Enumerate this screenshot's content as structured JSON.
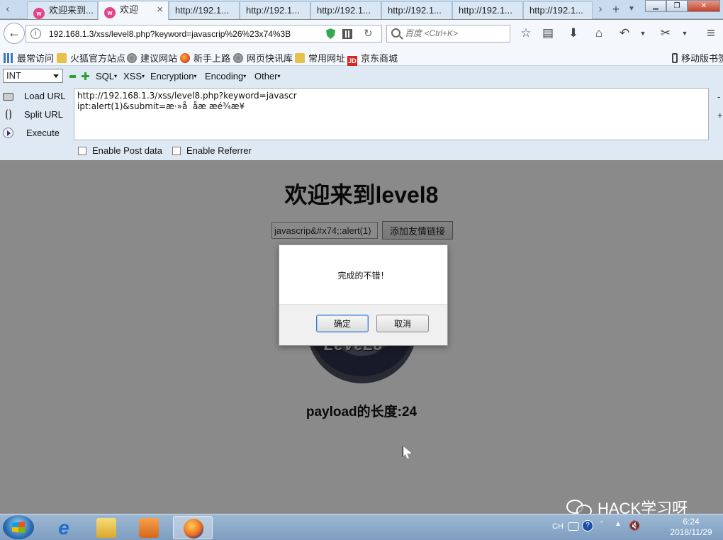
{
  "tabs": [
    {
      "label": "欢迎来到...",
      "active": false
    },
    {
      "label": "欢迎",
      "active": true
    },
    {
      "label": "http://192.1...",
      "active": false
    },
    {
      "label": "http://192.1...",
      "active": false
    },
    {
      "label": "http://192.1...",
      "active": false
    },
    {
      "label": "http://192.1...",
      "active": false
    },
    {
      "label": "http://192.1...",
      "active": false
    },
    {
      "label": "http://192.1...",
      "active": false
    }
  ],
  "nav": {
    "url": "192.168.1.3/xss/level8.php?keyword=javascrip%26%23x74%3B",
    "search_placeholder": "百度 <Ctrl+K>"
  },
  "bookmarks": [
    {
      "label": "最常访问",
      "icon": "grid-icon"
    },
    {
      "label": "火狐官方站点",
      "icon": "folder-icon"
    },
    {
      "label": "建议网站",
      "icon": "globe-icon"
    },
    {
      "label": "新手上路",
      "icon": "firefox-icon"
    },
    {
      "label": "网页快讯库",
      "icon": "globe-icon"
    },
    {
      "label": "常用网址",
      "icon": "folder-icon"
    },
    {
      "label": "京东商城",
      "icon": "jd-icon"
    },
    {
      "label": "移动版书签",
      "icon": "phone-icon"
    }
  ],
  "hackbar": {
    "select_value": "INT",
    "menus": [
      "SQL",
      "XSS",
      "Encryption",
      "Encoding",
      "Other"
    ],
    "load_url": "Load URL",
    "split_url": "Split URL",
    "execute": "Execute",
    "textarea_value": "http://192.168.1.3/xss/level8.php?keyword=javascr\nipt:alert(1)&submit=æ·»å  åæ æé¾æ¥",
    "enable_post": "Enable Post data",
    "enable_referrer": "Enable Referrer",
    "side_minus": "-",
    "side_plus": "+"
  },
  "page": {
    "title": "欢迎来到level8",
    "input_value": "javascrip&#x74;:alert(1)",
    "button_label": "添加友情链接",
    "logo_text": "LeVeL8",
    "payload_length": "payload的长度:24"
  },
  "dialog": {
    "message": "完成的不错！",
    "ok_label": "确定",
    "cancel_label": "取消"
  },
  "watermark": "HACK学习呀",
  "taskbar": {
    "lang": "CH",
    "time": "6:24",
    "date": "2018/11/29"
  }
}
